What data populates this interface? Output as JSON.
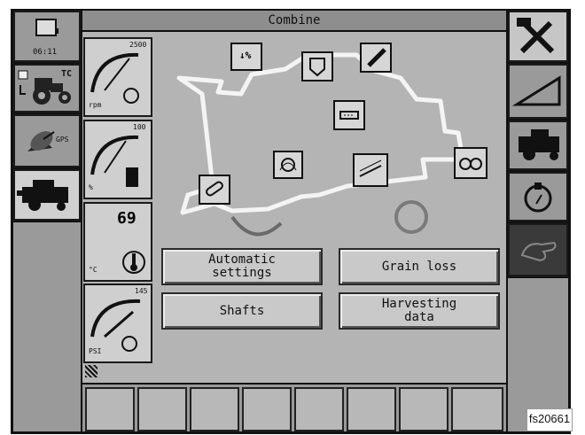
{
  "header": {
    "title": "Combine"
  },
  "left_sidebar": {
    "clock_time": "06:11",
    "tractor_label": "TC",
    "gps_label": "GPS"
  },
  "gauges": {
    "rpm": {
      "max": "2500",
      "unit": "rpm"
    },
    "fuel": {
      "max": "100",
      "unit": "%"
    },
    "temperature": {
      "value": "69",
      "unit": "°C"
    },
    "pressure": {
      "max": "145",
      "unit": "PSI"
    }
  },
  "buttons": {
    "automatic_settings": "Automatic\nsettings",
    "grain_loss": "Grain loss",
    "shafts": "Shafts",
    "harvesting_data": "Harvesting\ndata"
  },
  "figure_id": "fs20661",
  "icons": [
    "clock-icon",
    "tractor-icon",
    "gps-antenna-icon",
    "combine-icon",
    "tools-icon",
    "slope-icon",
    "combine-side-icon",
    "engine-oil-icon",
    "hand-icon"
  ]
}
